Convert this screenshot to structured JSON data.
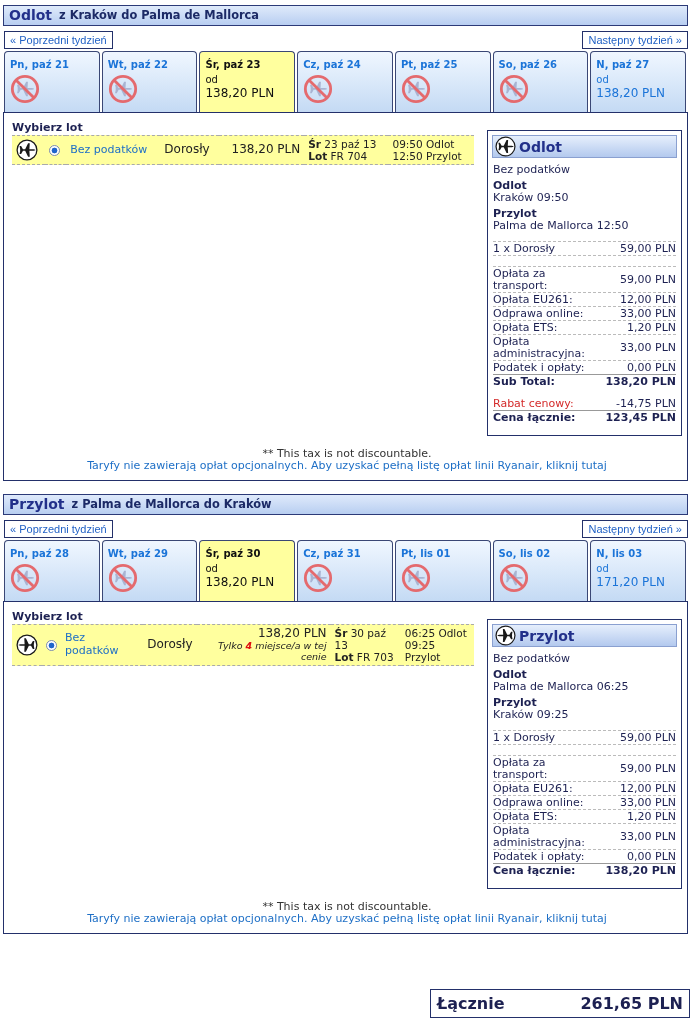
{
  "sections": [
    {
      "kind": "outbound",
      "title": "Odlot",
      "route": "z Kraków do Palma de Mallorca",
      "prev_week": "« Poprzedni tydzień",
      "next_week": "Następny tydzień »",
      "days": [
        {
          "label": "Pn, paź 21",
          "available": false,
          "selected": false
        },
        {
          "label": "Wt, paź 22",
          "available": false,
          "selected": false
        },
        {
          "label": "Śr, paź 23",
          "available": true,
          "selected": true,
          "from": "od",
          "price": "138,20 PLN"
        },
        {
          "label": "Cz, paź 24",
          "available": false,
          "selected": false
        },
        {
          "label": "Pt, paź 25",
          "available": false,
          "selected": false
        },
        {
          "label": "So, paź 26",
          "available": false,
          "selected": false
        },
        {
          "label": "N, paź 27",
          "available": true,
          "selected": false,
          "from": "od",
          "price": "138,20 PLN"
        }
      ],
      "select_title": "Wybierz lot",
      "flights": [
        {
          "selected": true,
          "fare": "Bez podatków",
          "passenger": "Dorosły",
          "price": "138,20 PLN",
          "date": "**Śr** 23 paź 13",
          "flight": "**Lot** FR 704",
          "times": [
            "09:50 Odlot",
            "12:50 Przylot"
          ]
        }
      ],
      "summary": {
        "title": "Odlot",
        "fare": "Bez podatków",
        "legs": [
          {
            "label": "Odlot",
            "value": "Kraków 09:50"
          },
          {
            "label": "Przylot",
            "value": "Palma de Mallorca 12:50"
          }
        ],
        "passengers": [
          {
            "label": "1 x Dorosły",
            "value": "59,00 PLN"
          }
        ],
        "fees": [
          {
            "label": "Opłata za transport:",
            "value": "59,00 PLN"
          },
          {
            "label": "Opłata EU261:",
            "value": "12,00 PLN"
          },
          {
            "label": "Odprawa online:",
            "value": "33,00 PLN"
          },
          {
            "label": "Opłata ETS:",
            "value": "1,20 PLN"
          },
          {
            "label": "Opłata administracyjna:",
            "value": "33,00 PLN"
          },
          {
            "label": "Podatek i opłaty:",
            "value": "0,00 PLN"
          }
        ],
        "totals": [
          {
            "kind": "subtotal",
            "label": "Sub Total:",
            "value": "138,20 PLN"
          },
          {
            "kind": "discount",
            "label": "Rabat cenowy:",
            "value": "-14,75 PLN"
          },
          {
            "kind": "total",
            "label": "Cena łącznie:",
            "value": "123,45 PLN"
          }
        ]
      },
      "tax_note": "** This tax is not discountable.",
      "fees_link": "Taryfy nie zawierają opłat opcjonalnych. Aby uzyskać pełną listę opłat linii Ryanair, kliknij tutaj"
    },
    {
      "kind": "inbound",
      "title": "Przylot",
      "route": "z Palma de Mallorca do Kraków",
      "prev_week": "« Poprzedni tydzień",
      "next_week": "Następny tydzień »",
      "days": [
        {
          "label": "Pn, paź 28",
          "available": false,
          "selected": false
        },
        {
          "label": "Wt, paź 29",
          "available": false,
          "selected": false
        },
        {
          "label": "Śr, paź 30",
          "available": true,
          "selected": true,
          "from": "od",
          "price": "138,20 PLN"
        },
        {
          "label": "Cz, paź 31",
          "available": false,
          "selected": false
        },
        {
          "label": "Pt, lis 01",
          "available": false,
          "selected": false
        },
        {
          "label": "So, lis 02",
          "available": false,
          "selected": false
        },
        {
          "label": "N, lis 03",
          "available": true,
          "selected": false,
          "from": "od",
          "price": "171,20 PLN"
        }
      ],
      "select_title": "Wybierz lot",
      "flights": [
        {
          "selected": true,
          "fare": "Bez podatków",
          "passenger": "Dorosły",
          "price": "138,20 PLN",
          "seats_note": "Tylko **4** miejsce/a w tej cenie",
          "date": "**Śr** 30 paź 13",
          "flight": "**Lot** FR 703",
          "times": [
            "06:25 Odlot",
            "09:25 Przylot"
          ]
        }
      ],
      "summary": {
        "title": "Przylot",
        "fare": "Bez podatków",
        "legs": [
          {
            "label": "Odlot",
            "value": "Palma de Mallorca 06:25"
          },
          {
            "label": "Przylot",
            "value": "Kraków 09:25"
          }
        ],
        "passengers": [
          {
            "label": "1 x Dorosły",
            "value": "59,00 PLN"
          }
        ],
        "fees": [
          {
            "label": "Opłata za transport:",
            "value": "59,00 PLN"
          },
          {
            "label": "Opłata EU261:",
            "value": "12,00 PLN"
          },
          {
            "label": "Odprawa online:",
            "value": "33,00 PLN"
          },
          {
            "label": "Opłata ETS:",
            "value": "1,20 PLN"
          },
          {
            "label": "Opłata administracyjna:",
            "value": "33,00 PLN"
          },
          {
            "label": "Podatek i opłaty:",
            "value": "0,00 PLN"
          }
        ],
        "totals": [
          {
            "kind": "total",
            "label": "Cena łącznie:",
            "value": "138,20 PLN"
          }
        ]
      },
      "tax_note": "** This tax is not discountable.",
      "fees_link": "Taryfy nie zawierają opłat opcjonalnych. Aby uzyskać pełną listę opłat linii Ryanair, kliknij tutaj"
    }
  ],
  "grand_total": {
    "label": "Łącznie",
    "value": "261,65 PLN"
  }
}
